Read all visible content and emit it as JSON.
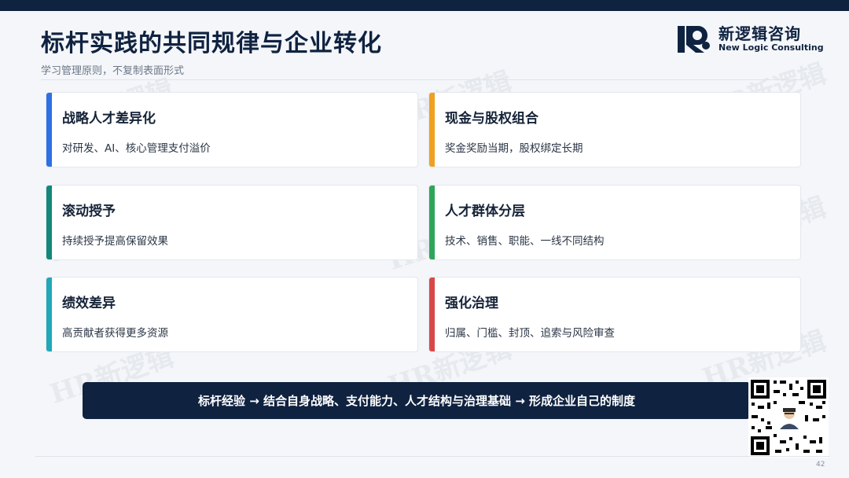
{
  "header": {
    "title": "标杆实践的共同规律与企业转化",
    "subtitle": "学习管理原则，不复制表面形式"
  },
  "logo": {
    "cn": "新逻辑咨询",
    "en": "New Logic Consulting"
  },
  "cards": [
    {
      "title": "战略人才差异化",
      "desc": "对研发、AI、核心管理支付溢价",
      "color": "#2f6fe4"
    },
    {
      "title": "现金与股权组合",
      "desc": "奖金奖励当期，股权绑定长期",
      "color": "#f0a020"
    },
    {
      "title": "滚动授予",
      "desc": "持续授予提高保留效果",
      "color": "#14867a"
    },
    {
      "title": "人才群体分层",
      "desc": "技术、销售、职能、一线不同结构",
      "color": "#2ea55a"
    },
    {
      "title": "绩效差异",
      "desc": "高贡献者获得更多资源",
      "color": "#20a8b8"
    },
    {
      "title": "强化治理",
      "desc": "归属、门槛、封顶、追索与风险审查",
      "color": "#d94848"
    }
  ],
  "banner": {
    "text": "标杆经验 → 结合自身战略、支付能力、人才结构与治理基础 → 形成企业自己的制度"
  },
  "watermark": "HR新逻辑",
  "page_number": "42"
}
